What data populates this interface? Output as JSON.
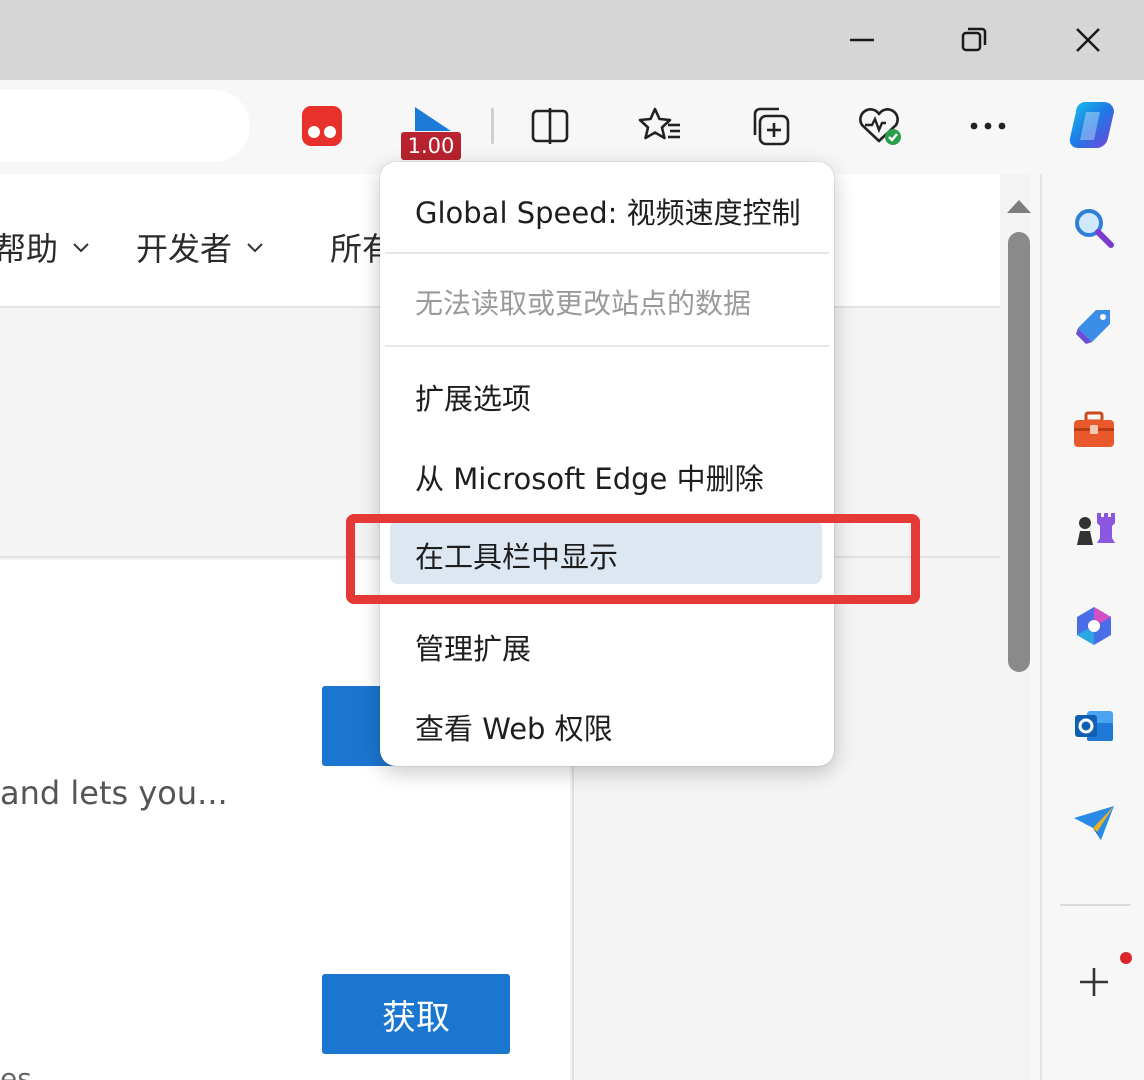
{
  "toolbar": {
    "speed_badge": "1.00"
  },
  "page": {
    "nav": [
      "帮助",
      "开发者",
      "所有"
    ],
    "description_fragment": "and lets you...",
    "get_button": "获取",
    "bottom_fragment": "es"
  },
  "menu": {
    "title": "Global Speed: 视频速度控制",
    "disabled_note": "无法读取或更改站点的数据",
    "items": [
      {
        "label": "扩展选项",
        "highlighted": false
      },
      {
        "label": "从 Microsoft Edge 中删除",
        "highlighted": false
      },
      {
        "label": "在工具栏中显示",
        "highlighted": true
      },
      {
        "label": "管理扩展",
        "highlighted": false
      },
      {
        "label": "查看 Web 权限",
        "highlighted": false
      }
    ]
  },
  "icons": {
    "titlebar": [
      "minimize-icon",
      "restore-icon",
      "close-icon"
    ],
    "toolbar": [
      "tampermonkey-icon",
      "global-speed-icon",
      "split-screen-icon",
      "favorites-icon",
      "collections-icon",
      "browser-essentials-icon",
      "more-icon",
      "copilot-icon"
    ],
    "sidebar": [
      "search-icon",
      "shopping-tag-icon",
      "tools-icon",
      "games-icon",
      "microsoft-365-icon",
      "outlook-icon",
      "drop-icon",
      "add-icon"
    ]
  },
  "colors": {
    "accent_blue": "#1b76d0",
    "highlight_frame": "#e53935",
    "badge_red": "#b8232f",
    "menu_highlight": "#dce7f1"
  }
}
